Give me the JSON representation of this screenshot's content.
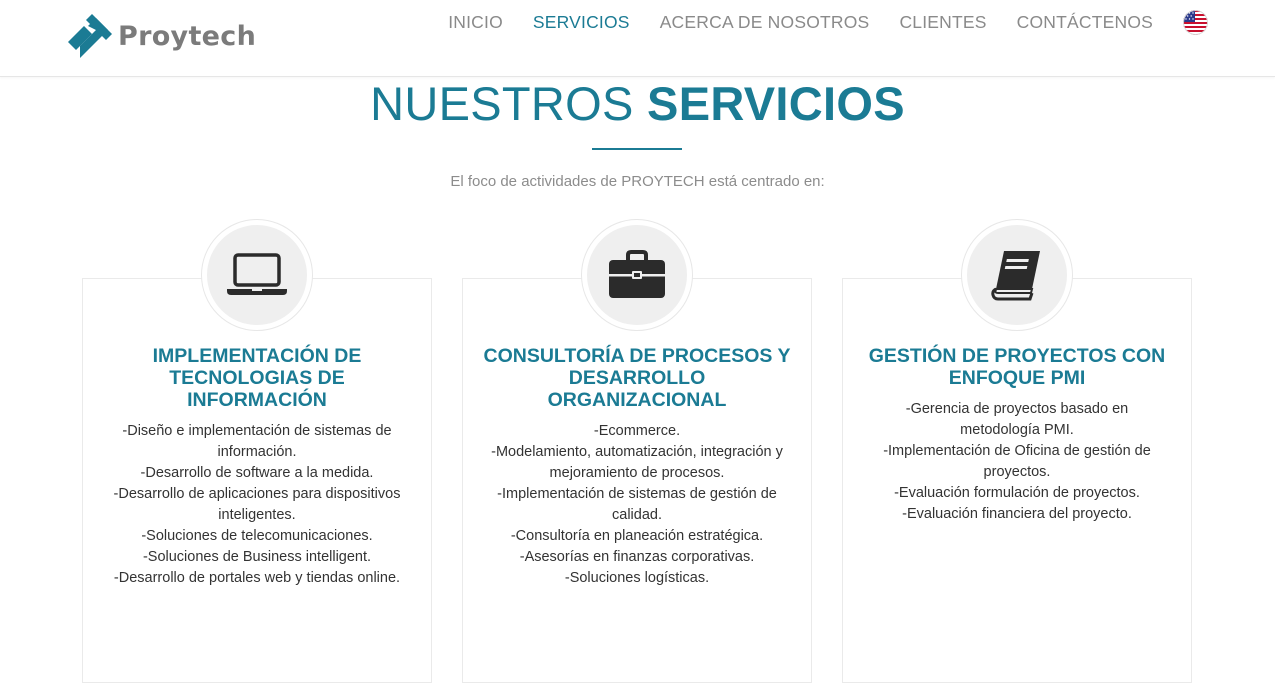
{
  "brand": {
    "name": "Proytech",
    "accent": "#1b7b94",
    "text_gray": "#7b7b7b"
  },
  "nav": {
    "items": [
      {
        "label": "INICIO"
      },
      {
        "label": "SERVICIOS",
        "active": true
      },
      {
        "label": "ACERCA DE NOSOTROS"
      },
      {
        "label": "CLIENTES"
      },
      {
        "label": "CONTÁCTENOS"
      }
    ],
    "language_flag": "us-flag-icon"
  },
  "section": {
    "title_light": "NUESTROS",
    "title_bold": "SERVICIOS",
    "subtitle": "El foco de actividades de PROYTECH está centrado en:"
  },
  "cards": [
    {
      "icon": "laptop-icon",
      "title": "IMPLEMENTACIÓN DE TECNOLOGIAS DE INFORMACIÓN",
      "items": [
        "-Diseño e implementación de sistemas de información.",
        "-Desarrollo de software a la medida.",
        "-Desarrollo de aplicaciones para dispositivos inteligentes.",
        "-Soluciones de telecomunicaciones.",
        "-Soluciones de Business intelligent.",
        "-Desarrollo de portales web y tiendas online."
      ]
    },
    {
      "icon": "briefcase-icon",
      "title": "CONSULTORÍA DE PROCESOS Y DESARROLLO ORGANIZACIONAL",
      "items": [
        "-Ecommerce.",
        "-Modelamiento, automatización, integración y mejoramiento de procesos.",
        "-Implementación de sistemas de gestión de calidad.",
        "-Consultoría en planeación estratégica.",
        "-Asesorías en finanzas corporativas.",
        "-Soluciones logísticas."
      ]
    },
    {
      "icon": "book-icon",
      "title": "GESTIÓN DE PROYECTOS CON ENFOQUE PMI",
      "items": [
        "-Gerencia de proyectos basado en metodología PMI.",
        "-Implementación de Oficina de gestión de proyectos.",
        "-Evaluación formulación de proyectos.",
        "-Evaluación financiera del proyecto."
      ]
    }
  ]
}
